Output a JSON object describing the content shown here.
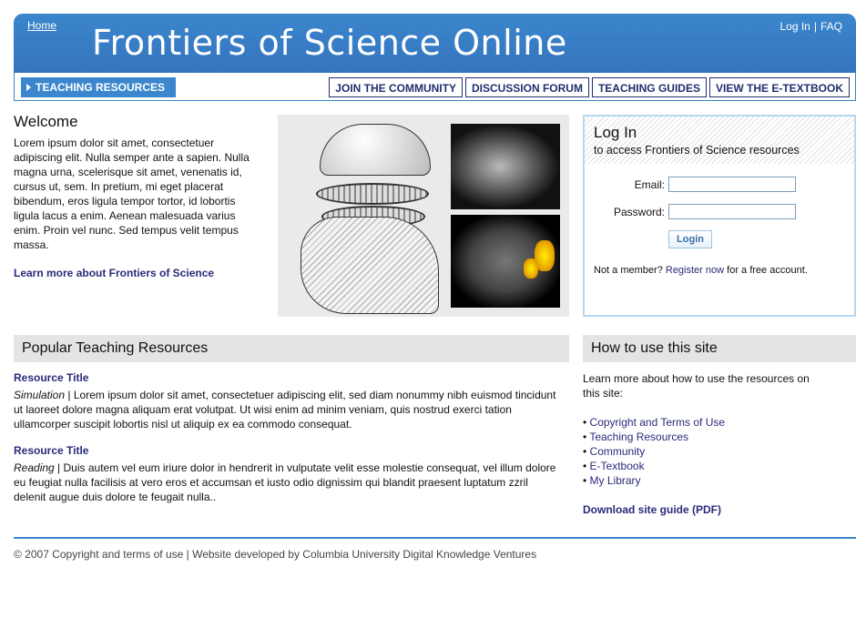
{
  "header": {
    "home": "Home",
    "title": "Frontiers of Science Online",
    "login_link": "Log In",
    "separator": "|",
    "faq_link": "FAQ"
  },
  "nav": {
    "current": "TEACHING RESOURCES",
    "tabs": [
      "JOIN THE COMMUNITY",
      "DISCUSSION FORUM",
      "TEACHING GUIDES",
      "VIEW THE E-TEXTBOOK"
    ]
  },
  "welcome": {
    "heading": "Welcome",
    "body": "Lorem ipsum dolor sit amet, consectetuer adipiscing elit. Nulla semper ante a sapien. Nulla magna urna, scelerisque sit amet, venenatis id, cursus ut, sem. In pretium, mi eget placerat bibendum, eros ligula tempor tortor, id lobortis ligula lacus a enim. Aenean malesuada varius enim. Proin vel nunc. Sed tempus velit tempus massa.",
    "more_link": "Learn more about Frontiers of Science"
  },
  "login": {
    "title": "Log In",
    "subtitle": "to access Frontiers of Science resources",
    "email_label": "Email:",
    "password_label": "Password:",
    "button": "Login",
    "member_prefix": "Not a member?",
    "register_link": "Register now",
    "member_suffix": "for a free account."
  },
  "popular": {
    "heading": "Popular Teaching Resources",
    "items": [
      {
        "title": "Resource Title",
        "type": "Simulation",
        "sep": "|",
        "body": "Lorem ipsum dolor sit amet, consectetuer adipiscing elit, sed diam nonummy nibh euismod tincidunt ut laoreet dolore magna aliquam erat volutpat. Ut wisi enim ad minim veniam, quis nostrud exerci tation ullamcorper suscipit lobortis nisl ut aliquip ex ea commodo consequat."
      },
      {
        "title": "Resource Title",
        "type": "Reading",
        "sep": "|",
        "body": "Duis autem vel eum iriure dolor in hendrerit in vulputate velit esse molestie consequat, vel illum dolore eu feugiat nulla facilisis at vero eros et accumsan et iusto odio dignissim qui blandit praesent luptatum zzril delenit augue duis dolore te feugait nulla.."
      }
    ]
  },
  "howto": {
    "heading": "How to use this site",
    "intro": "Learn more about how to use the resources on this site:",
    "links": [
      "Copyright and Terms of Use",
      "Teaching Resources",
      "Community",
      "E-Textbook",
      "My Library"
    ],
    "download": "Download site guide (PDF)"
  },
  "footer": {
    "copyright": "© 2007 Copyright and",
    "terms_link": "terms of use",
    "developed": "| Website developed by",
    "developer_link": "Columbia University Digital Knowledge Ventures"
  },
  "colors": {
    "brand_blue": "#3b86cc",
    "nav_text": "#1f2f70",
    "link": "#2a2a7a"
  }
}
